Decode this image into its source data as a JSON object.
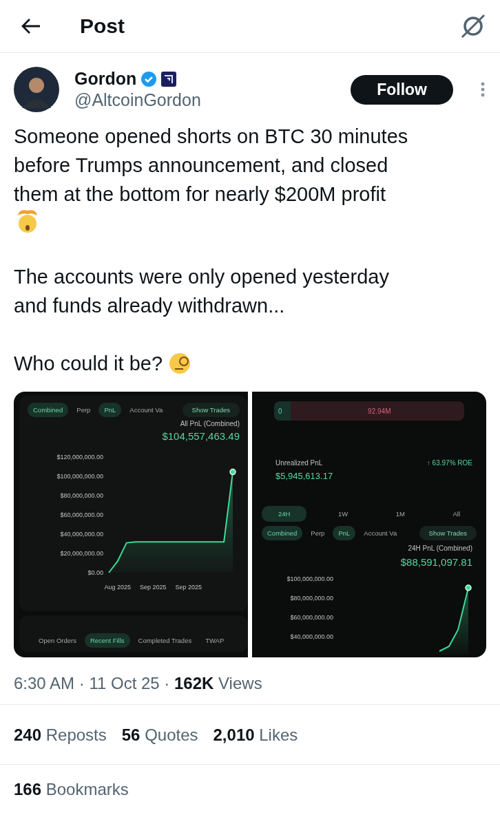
{
  "header": {
    "title": "Post"
  },
  "author": {
    "name": "Gordon",
    "handle": "@AltcoinGordon",
    "verified": true,
    "follow_label": "Follow"
  },
  "body": [
    {
      "kind": "text",
      "text": "Someone opened shorts on BTC 30 minutes\nbefore Trumps announcement, and closed\nthem at the bottom for nearly $200M profit"
    },
    {
      "kind": "exploding-emoji"
    },
    {
      "kind": "text",
      "text": "The accounts were only opened yesterday\nand funds already withdrawn..."
    },
    {
      "kind": "text-monocle",
      "text": "Who could it be?"
    }
  ],
  "media": [
    {
      "kind": "pnl",
      "tabs": [
        {
          "label": "Combined",
          "selected": true
        },
        {
          "label": "Perp",
          "selected": false
        },
        {
          "label": "PnL",
          "selected": true
        },
        {
          "label": "Account Va",
          "selected": false
        }
      ],
      "show_trades": "Show Trades",
      "pnl_label": "All PnL (Combined)",
      "pnl_value": "$104,557,463.49",
      "chart_data": {
        "type": "area",
        "categories": [
          null,
          "Aug 2025",
          null,
          null,
          null,
          "Sep 2025",
          null,
          null,
          null,
          "Sep 2025",
          null,
          null,
          null,
          null,
          null
        ],
        "ylim": [
          0,
          120000000
        ],
        "yticks": [
          {
            "value": 0,
            "label": "$0.00"
          },
          {
            "value": 20000000,
            "label": "$20,000,000.00"
          },
          {
            "value": 40000000,
            "label": "$40,000,000.00"
          },
          {
            "value": 60000000,
            "label": "$60,000,000.00"
          },
          {
            "value": 80000000,
            "label": "$80,000,000.00"
          },
          {
            "value": 100000000,
            "label": "$100,000,000.00"
          },
          {
            "value": 120000000,
            "label": "$120,000,000.00"
          }
        ],
        "series": [
          {
            "color": "#3ddc97",
            "values": [
              0,
              12000000,
              31000000,
              32000000,
              32000000,
              32000000,
              32000000,
              32000000,
              32000000,
              32000000,
              32000000,
              32000000,
              32000000,
              32000000,
              104600000
            ]
          }
        ]
      },
      "bottom_tabs": [
        {
          "label": "Open Orders",
          "selected": false
        },
        {
          "label": "Recent Fills",
          "selected": true
        },
        {
          "label": "Completed Trades",
          "selected": false
        },
        {
          "label": "TWAP",
          "selected": false
        }
      ]
    },
    {
      "kind": "position",
      "distribution": [
        {
          "label": "0",
          "color": "#16322a"
        },
        {
          "label": "92.94M",
          "color": "#2e1a1f"
        }
      ],
      "unrealized_label": "Unrealized PnL",
      "roe": "↑ 63.97% ROE",
      "unrealized_value": "$5,945,613.17",
      "periods": [
        {
          "label": "24H",
          "selected": true
        },
        {
          "label": "1W",
          "selected": false
        },
        {
          "label": "1M",
          "selected": false
        },
        {
          "label": "All",
          "selected": false
        }
      ],
      "tabs": [
        {
          "label": "Combined",
          "selected": true
        },
        {
          "label": "Perp",
          "selected": false
        },
        {
          "label": "PnL",
          "selected": true
        },
        {
          "label": "Account Va",
          "selected": false
        }
      ],
      "show_trades": "Show Trades",
      "pnl_label": "24H PnL (Combined)",
      "pnl_value": "$88,591,097.81",
      "axis_labels": [
        "$100,000,000.00",
        "$80,000,000.00",
        "$60,000,000.00",
        "$40,000,000.00"
      ]
    }
  ],
  "meta": "6:30 AM · 11 Oct 25 · **162K** Views",
  "stats": [
    "**240** Reposts",
    "**56** Quotes",
    "**2,010** Likes"
  ],
  "bookmarks": "**166** Bookmarks"
}
